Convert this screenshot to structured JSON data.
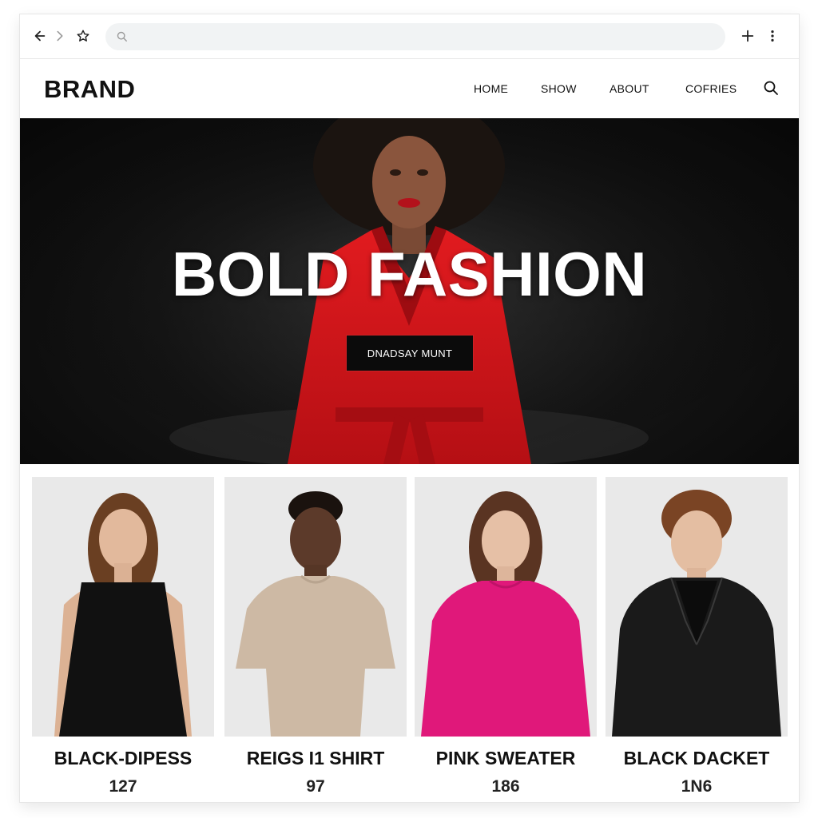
{
  "browser": {
    "address_placeholder": "",
    "icons": [
      "back-arrow-icon",
      "forward-arrow-icon",
      "star-icon",
      "search-icon",
      "plus-icon",
      "kebab-menu-icon"
    ]
  },
  "site": {
    "brand": "BRAND",
    "nav": [
      {
        "label": "HOME"
      },
      {
        "label": "SHOW"
      },
      {
        "label": "ABOUT"
      },
      {
        "label": "COFRIES"
      }
    ]
  },
  "hero": {
    "title": "BOLD FASHION",
    "cta_label": "DNADSAY MUNT",
    "accent_color": "#d9141a"
  },
  "products": [
    {
      "name": "BLACK-DIPESS",
      "price": "127"
    },
    {
      "name": "REIGS I1 SHIRT",
      "price": "97"
    },
    {
      "name": "PINK SWEATER",
      "price": "186"
    },
    {
      "name": "BLACK DACKET",
      "price": "1N6"
    }
  ],
  "colors": {
    "dress": "#111111",
    "shirt": "#cdb9a4",
    "sweater": "#e0187a",
    "jacket": "#1a1a1a"
  }
}
